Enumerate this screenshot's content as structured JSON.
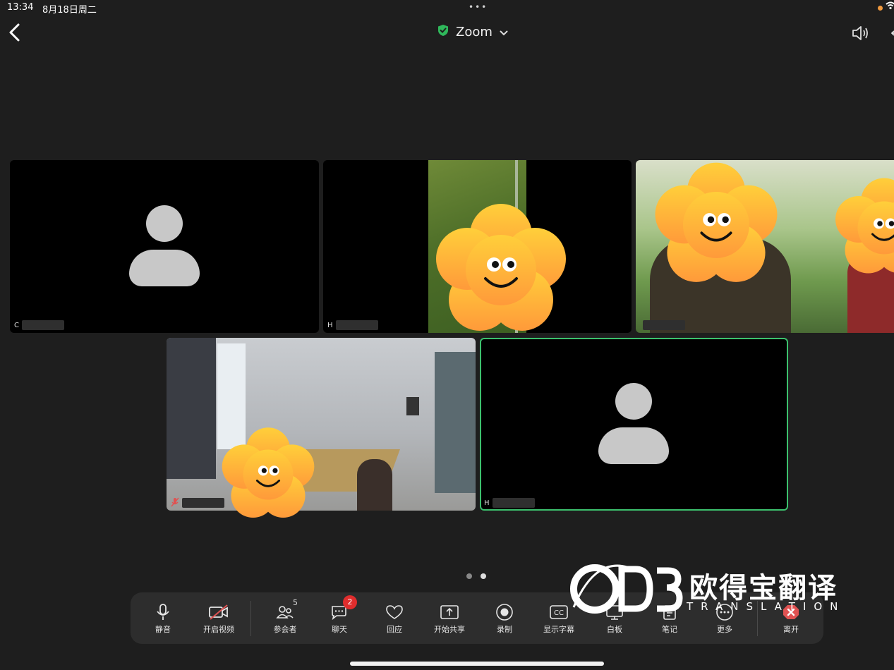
{
  "status_bar": {
    "time": "13:34",
    "date": "8月18日周二",
    "dots": "•••"
  },
  "header": {
    "title": "Zoom",
    "shield_color": "#2fb85b"
  },
  "participants": [
    {
      "initial": "C",
      "video": false
    },
    {
      "initial": "H",
      "video": true
    },
    {
      "initial": "",
      "video": true
    },
    {
      "initial": "",
      "video": true,
      "muted": true
    },
    {
      "initial": "H",
      "video": false,
      "active_speaker": true
    }
  ],
  "toolbar": {
    "mute": "静音",
    "start_video": "开启视频",
    "participants": "参会者",
    "participants_count": "5",
    "chat": "聊天",
    "chat_badge": "2",
    "reactions": "回应",
    "share": "开始共享",
    "record": "录制",
    "captions": "显示字幕",
    "whiteboard": "白板",
    "notes": "笔记",
    "more": "更多",
    "leave": "离开"
  },
  "watermark": {
    "logo": "ODB",
    "brand_cn": "欧得宝翻译",
    "brand_en": "TRANSLATION"
  },
  "colors": {
    "background": "#1e1e1e",
    "toolbar": "#2d2d2d",
    "active_border": "#3cc16d",
    "leave": "#e05252"
  }
}
